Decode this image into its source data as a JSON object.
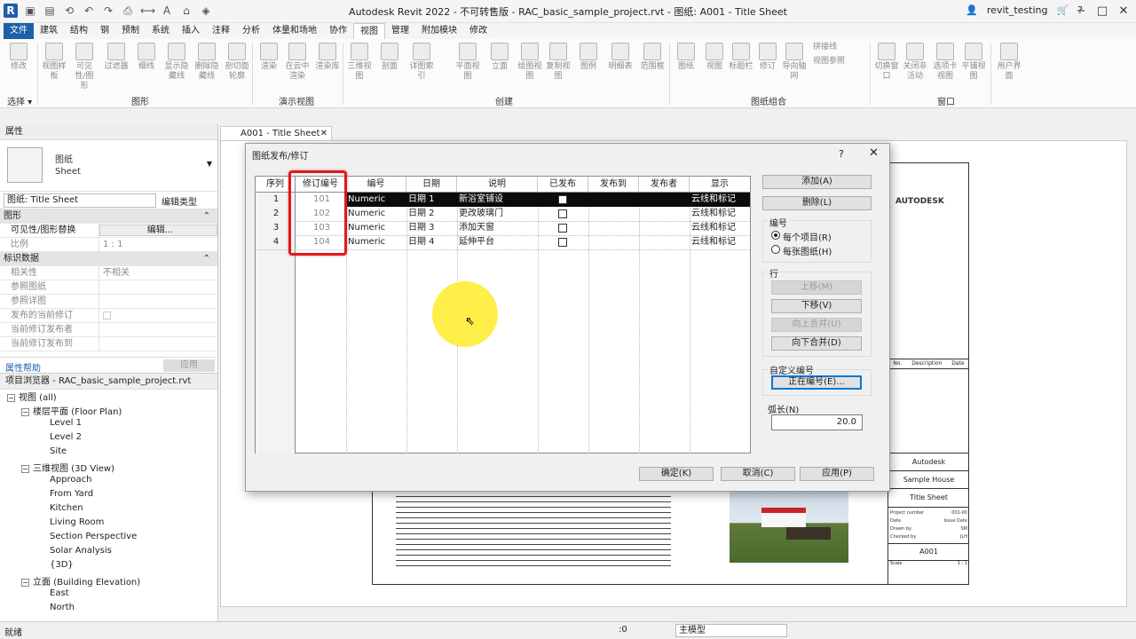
{
  "window": {
    "title": "Autodesk Revit 2022 - 不可转售版 - RAC_basic_sample_project.rvt - 图纸: A001 - Title Sheet",
    "user": "revit_testing"
  },
  "tabs": [
    "文件",
    "建筑",
    "结构",
    "钢",
    "预制",
    "系统",
    "插入",
    "注释",
    "分析",
    "体量和场地",
    "协作",
    "视图",
    "管理",
    "附加模块",
    "修改"
  ],
  "ribbon": {
    "buttons": [
      "修改",
      "视图样板",
      "可见性/图形",
      "过滤器",
      "细线",
      "显示隐藏线",
      "删除隐藏线",
      "剖切面轮廓",
      "渲染",
      "在云中渲染",
      "渲染库",
      "三维视图",
      "剖面",
      "详图索引",
      "平面视图",
      "立面",
      "绘图视图",
      "复制视图",
      "图例",
      "明细表",
      "范围框",
      "图纸",
      "视图",
      "标题栏",
      "修订",
      "导向轴网",
      "拼接线",
      "视图参照",
      "切换窗口",
      "关闭非活动",
      "选项卡视图",
      "平铺视图",
      "用户界面"
    ],
    "panels": {
      "select": "选择 ▾",
      "graphics": "图形",
      "presentation": "演示视图",
      "create": "创建",
      "sheet": "图纸组合",
      "window": "窗口"
    }
  },
  "properties": {
    "header": "属性",
    "type_name": "图纸",
    "type_sub": "Sheet",
    "instance_selector": "图纸: Title Sheet",
    "edit_type": "编辑类型",
    "groups": [
      {
        "title": "图形",
        "rows": [
          {
            "key": "可见性/图形替换",
            "value": "编辑..."
          },
          {
            "key": "比例",
            "value": "1 : 1"
          }
        ]
      },
      {
        "title": "标识数据",
        "rows": [
          {
            "key": "相关性",
            "value": "不相关"
          },
          {
            "key": "参照图纸",
            "value": ""
          },
          {
            "key": "参照详图",
            "value": ""
          },
          {
            "key": "发布的当前修订",
            "value": ""
          },
          {
            "key": "当前修订发布者",
            "value": ""
          },
          {
            "key": "当前修订发布到",
            "value": ""
          }
        ]
      }
    ],
    "help_link": "属性帮助",
    "apply": "应用"
  },
  "browser": {
    "header": "项目浏览器 - RAC_basic_sample_project.rvt",
    "nodes": [
      {
        "label": "视图 (all)",
        "level": 0,
        "toggle": "−"
      },
      {
        "label": "楼层平面 (Floor Plan)",
        "level": 1,
        "toggle": "−"
      },
      {
        "label": "Level 1",
        "level": 2
      },
      {
        "label": "Level 2",
        "level": 2
      },
      {
        "label": "Site",
        "level": 2
      },
      {
        "label": "三维视图 (3D View)",
        "level": 1,
        "toggle": "−"
      },
      {
        "label": "Approach",
        "level": 2
      },
      {
        "label": "From Yard",
        "level": 2
      },
      {
        "label": "Kitchen",
        "level": 2
      },
      {
        "label": "Living Room",
        "level": 2
      },
      {
        "label": "Section Perspective",
        "level": 2
      },
      {
        "label": "Solar Analysis",
        "level": 2
      },
      {
        "label": "{3D}",
        "level": 2
      },
      {
        "label": "立面 (Building Elevation)",
        "level": 1,
        "toggle": "−"
      },
      {
        "label": "East",
        "level": 2
      },
      {
        "label": "North",
        "level": 2
      }
    ]
  },
  "view_tab": {
    "label": "A001 - Title Sheet"
  },
  "sheet": {
    "logo": "AUTODESK",
    "client": "Autodesk",
    "project": "Sample House",
    "sheet_name": "Title Sheet",
    "sheet_number": "A001",
    "labels": {
      "project_number": "Project number",
      "date": "Date",
      "drawn_by": "Drawn by",
      "checked_by": "Checked by",
      "scale": "Scale"
    },
    "values": {
      "project_number": "001-00",
      "date": "Issue Date",
      "drawn_by": "SM",
      "checked_by": "JLH",
      "scale": "1 : 1"
    },
    "rev_headers": [
      "No.",
      "Description",
      "Date"
    ]
  },
  "dialog": {
    "title": "图纸发布/修订",
    "help": "?",
    "columns": [
      "序列",
      "修订编号",
      "编号",
      "日期",
      "说明",
      "已发布",
      "发布到",
      "发布者",
      "显示"
    ],
    "rows": [
      {
        "seq": "1",
        "rev_no": "101",
        "numbering": "Numeric",
        "date": "日期 1",
        "desc": "新浴室铺设",
        "issued": false,
        "to": "",
        "by": "",
        "show": "云线和标记"
      },
      {
        "seq": "2",
        "rev_no": "102",
        "numbering": "Numeric",
        "date": "日期 2",
        "desc": "更改玻璃门",
        "issued": false,
        "to": "",
        "by": "",
        "show": "云线和标记"
      },
      {
        "seq": "3",
        "rev_no": "103",
        "numbering": "Numeric",
        "date": "日期 3",
        "desc": "添加天窗",
        "issued": false,
        "to": "",
        "by": "",
        "show": "云线和标记"
      },
      {
        "seq": "4",
        "rev_no": "104",
        "numbering": "Numeric",
        "date": "日期 4",
        "desc": "延伸平台",
        "issued": false,
        "to": "",
        "by": "",
        "show": "云线和标记"
      }
    ],
    "buttons": {
      "add": "添加(A)",
      "delete": "删除(L)",
      "numbering_label": "编号",
      "per_project": "每个项目(R)",
      "per_sheet": "每张图纸(H)",
      "row_label": "行",
      "move_up": "上移(M)",
      "move_down": "下移(V)",
      "merge_up": "向上合并(U)",
      "merge_down": "向下合并(D)",
      "custom_label": "自定义编号",
      "numbering_btn": "正在编号(E)...",
      "arc_label": "弧长(N)",
      "arc_value": "20.0",
      "ok": "确定(K)",
      "cancel": "取消(C)",
      "apply": "应用(P)"
    }
  },
  "statusbar": {
    "text": "就绪",
    "zero": ":0",
    "model": "主模型"
  }
}
